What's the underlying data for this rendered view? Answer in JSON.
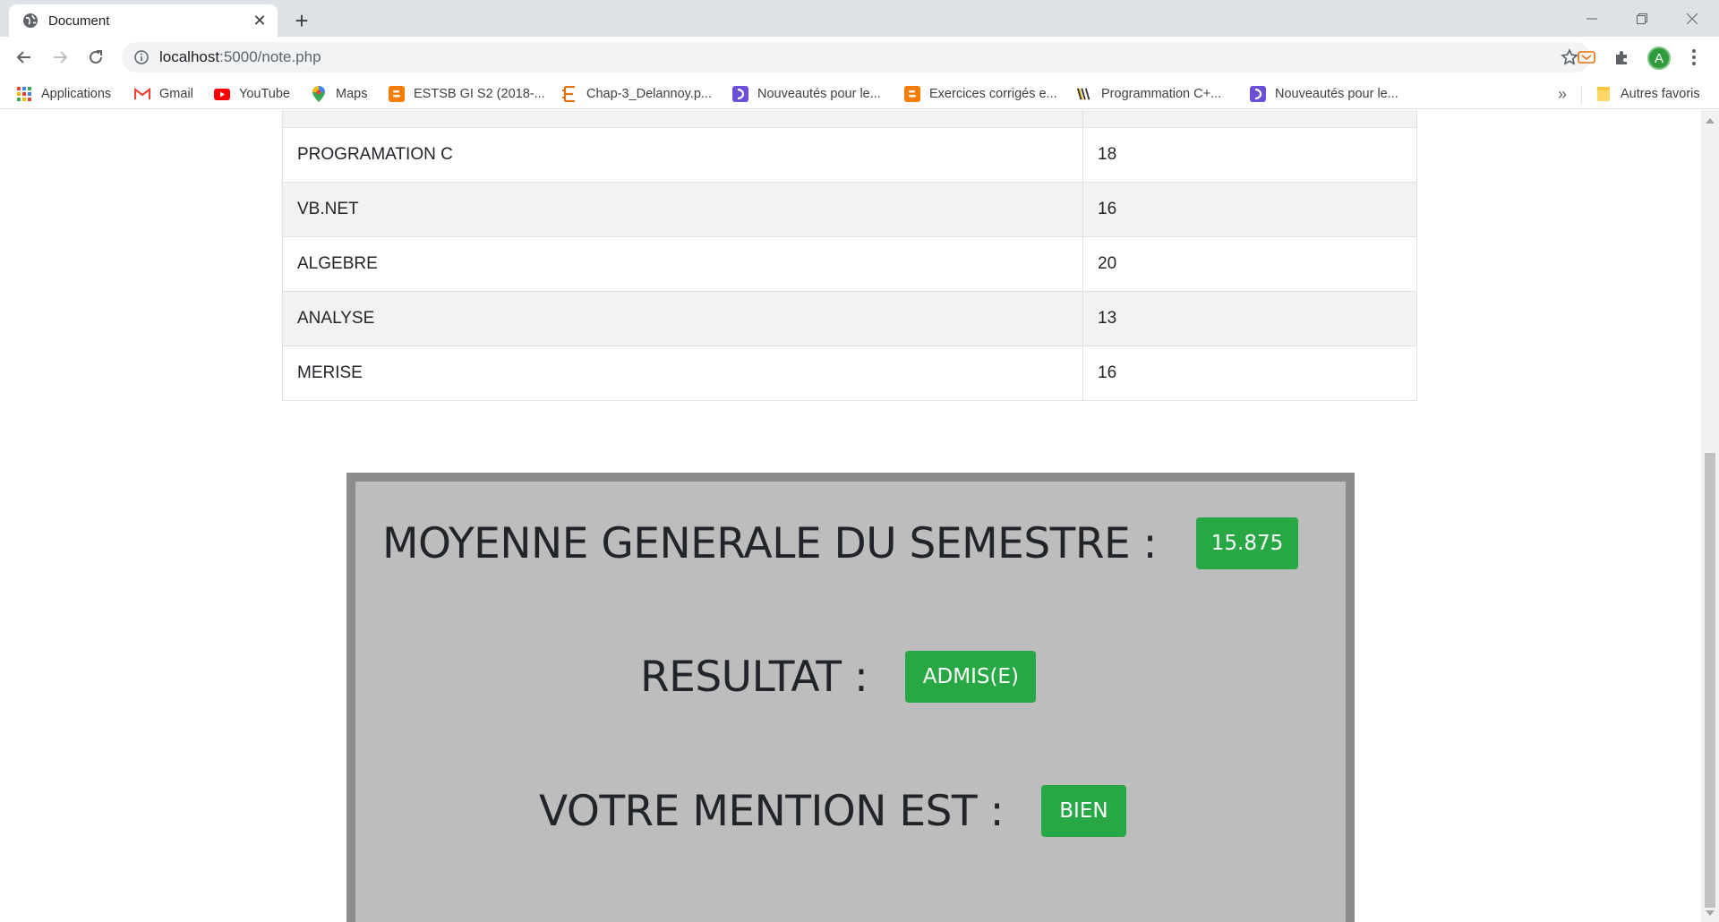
{
  "browser": {
    "tab": {
      "title": "Document",
      "icon": "globe-icon"
    },
    "new_tab_symbol": "+",
    "address": {
      "host": "localhost",
      "path": ":5000/note.php"
    },
    "profile_initial": "A",
    "bookmarks": [
      {
        "label": "Applications",
        "icon": "apps-grid-icon"
      },
      {
        "label": "Gmail",
        "icon": "gmail-icon"
      },
      {
        "label": "YouTube",
        "icon": "youtube-icon"
      },
      {
        "label": "Maps",
        "icon": "maps-icon"
      },
      {
        "label": "ESTSB GI S2 (2018-...",
        "icon": "blogger-icon"
      },
      {
        "label": "Chap-3_Delannoy.p...",
        "icon": "document-e-icon"
      },
      {
        "label": "Nouveautés pour le...",
        "icon": "bookmark-purple-icon"
      },
      {
        "label": "Exercices corrigés e...",
        "icon": "blogger-icon"
      },
      {
        "label": "Programmation C+...",
        "icon": "site-logo-icon"
      },
      {
        "label": "Nouveautés pour le...",
        "icon": "bookmark-purple-icon"
      }
    ],
    "bookmarks_overflow": "»",
    "other_bookmarks": "Autres favoris"
  },
  "grades": {
    "rows": [
      {
        "subject": "PROGRAMATION C",
        "mark": "18"
      },
      {
        "subject": "VB.NET",
        "mark": "16"
      },
      {
        "subject": "ALGEBRE",
        "mark": "20"
      },
      {
        "subject": "ANALYSE",
        "mark": "13"
      },
      {
        "subject": "MERISE",
        "mark": "16"
      }
    ]
  },
  "result": {
    "average_label": "MOYENNE GENERALE DU SEMESTRE :",
    "average_value": "15.875",
    "result_label": "RESULTAT :",
    "result_value": "ADMIS(E)",
    "mention_label": "VOTRE MENTION EST :",
    "mention_value": "BIEN"
  },
  "colors": {
    "badge_green": "#28a745",
    "result_bg": "#bdbdbd",
    "result_border": "#8c8c8c"
  }
}
